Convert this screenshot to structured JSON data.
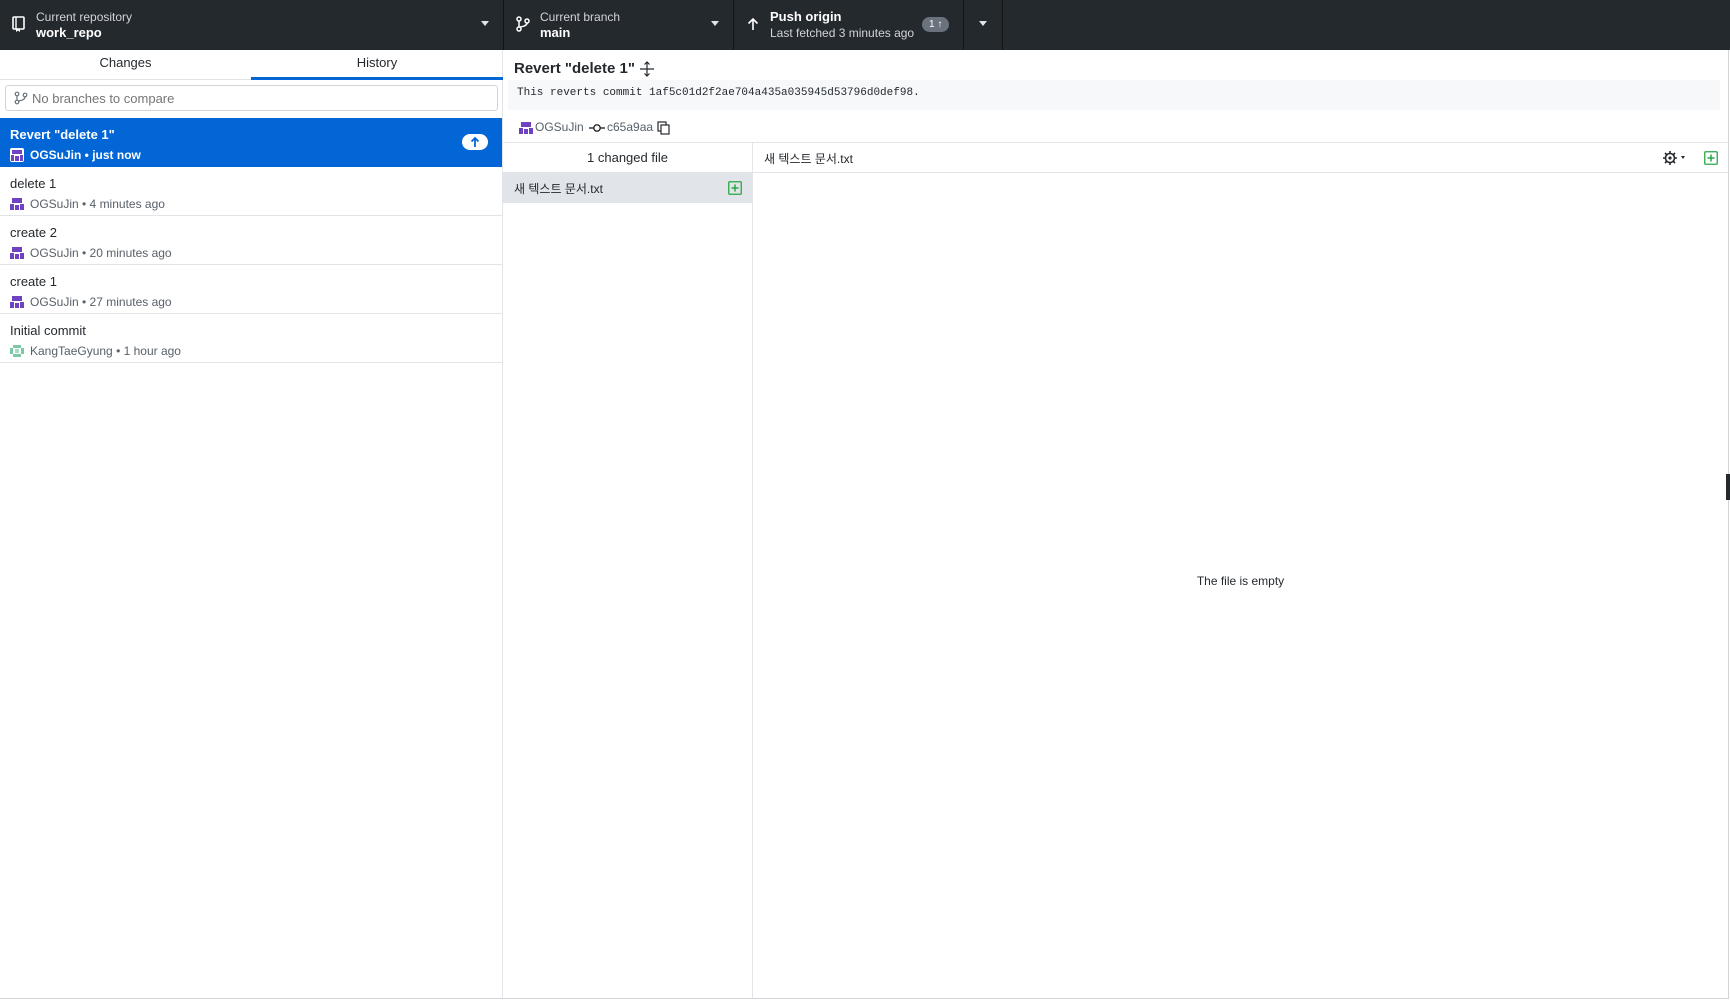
{
  "toolbar": {
    "repository": {
      "label": "Current repository",
      "value": "work_repo"
    },
    "branch": {
      "label": "Current branch",
      "value": "main"
    },
    "push": {
      "label": "Push origin",
      "status": "Last fetched 3 minutes ago",
      "badge": "1 ↑"
    }
  },
  "sidebar": {
    "tabs": [
      {
        "label": "Changes"
      },
      {
        "label": "History"
      }
    ],
    "selected_tab": "History",
    "compare": {
      "placeholder": "No branches to compare"
    },
    "commits": [
      {
        "title": "Revert \"delete 1\"",
        "meta": "OGSuJin • just now",
        "selected": true
      },
      {
        "title": "delete 1",
        "meta": "OGSuJin • 4 minutes ago"
      },
      {
        "title": "create 2",
        "meta": "OGSuJin • 20 minutes ago"
      },
      {
        "title": "create 1",
        "meta": "OGSuJin • 27 minutes ago"
      },
      {
        "title": "Initial commit",
        "meta": "KangTaeGyung • 1 hour ago"
      }
    ]
  },
  "detail": {
    "title": "Revert \"delete 1\"",
    "description": "This reverts commit 1af5c01d2f2ae704a435a035945d53796d0def98.",
    "author": "OGSuJin",
    "sha": "c65a9aa",
    "changed_files_label": "1 changed file",
    "files": [
      {
        "name": "새 텍스트 문서.txt",
        "status": "added"
      }
    ],
    "diff": {
      "filename": "새 텍스트 문서.txt",
      "empty_message": "The file is empty"
    }
  },
  "colors": {
    "toolbar_bg": "#24292e",
    "accent": "#0366d6",
    "added_green": "#28a745",
    "avatar_purple": "#6f42c1"
  },
  "icons": [
    "repo-icon",
    "branch-icon",
    "arrow-up-icon",
    "caret-down-icon",
    "git-compare-icon",
    "avatar-icon",
    "expand-icon",
    "commit-icon",
    "copy-icon",
    "file-added-icon",
    "gear-icon"
  ]
}
